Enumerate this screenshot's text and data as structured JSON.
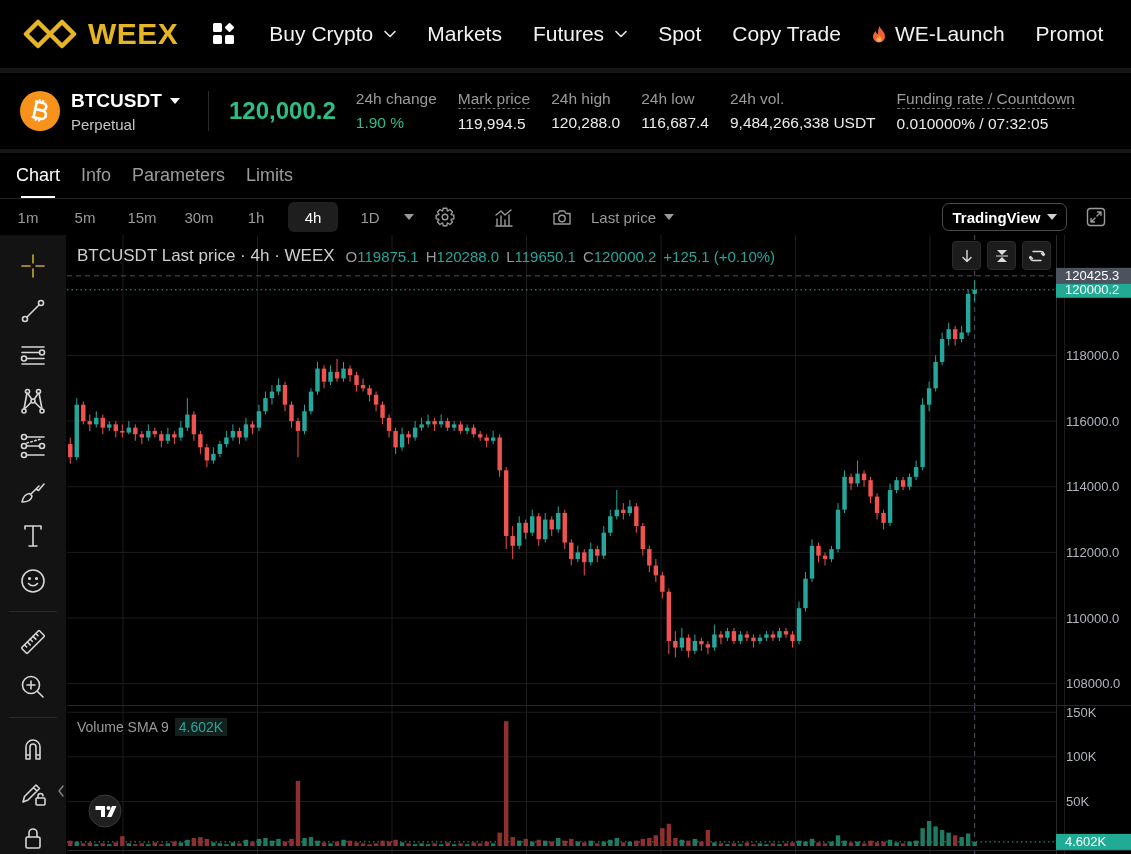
{
  "nav": {
    "logo": "WEEX",
    "items": [
      {
        "label": "Buy Crypto",
        "kind": "dropdown"
      },
      {
        "label": "Markets",
        "kind": "link"
      },
      {
        "label": "Futures",
        "kind": "dropdown"
      },
      {
        "label": "Spot",
        "kind": "link"
      },
      {
        "label": "Copy Trade",
        "kind": "link"
      },
      {
        "label": "WE-Launch",
        "kind": "hot"
      },
      {
        "label": "Promot",
        "kind": "link"
      }
    ]
  },
  "ticker": {
    "symbol": "BTCUSDT",
    "contract": "Perpetual",
    "last_price": "120,000.2",
    "stats": [
      {
        "label": "24h change",
        "value": "1.90 %",
        "kind": "change"
      },
      {
        "label": "Mark price",
        "value": "119,994.5",
        "kind": "hint"
      },
      {
        "label": "24h high",
        "value": "120,288.0",
        "kind": "plain"
      },
      {
        "label": "24h low",
        "value": "116,687.4",
        "kind": "plain"
      },
      {
        "label": "24h vol.",
        "value": "9,484,266,338 USDT",
        "kind": "plain"
      },
      {
        "label": "Funding rate / Countdown",
        "value": "0.010000% / 07:32:05",
        "kind": "hint"
      }
    ]
  },
  "tabs": [
    {
      "label": "Chart",
      "selected": true
    },
    {
      "label": "Info",
      "selected": false
    },
    {
      "label": "Parameters",
      "selected": false
    },
    {
      "label": "Limits",
      "selected": false
    }
  ],
  "toolbar": {
    "intervals": [
      {
        "label": "1m",
        "selected": false
      },
      {
        "label": "5m",
        "selected": false
      },
      {
        "label": "15m",
        "selected": false
      },
      {
        "label": "30m",
        "selected": false
      },
      {
        "label": "1h",
        "selected": false
      },
      {
        "label": "4h",
        "selected": true
      },
      {
        "label": "1D",
        "selected": false
      }
    ],
    "price_source": "Last price",
    "chart_type": "TradingView"
  },
  "chart": {
    "legend": {
      "title": "BTCUSDT Last price · 4h · WEEX",
      "ohlc": [
        {
          "key": "O",
          "value": "119875.1"
        },
        {
          "key": "H",
          "value": "120288.0"
        },
        {
          "key": "L",
          "value": "119650.1"
        },
        {
          "key": "C",
          "value": "120000.2"
        }
      ],
      "change": "+125.1 (+0.10%)"
    },
    "tool_groups": [
      {
        "tools": [
          {
            "kind": "crosshair",
            "selected": true
          },
          {
            "kind": "trend-line",
            "selected": false
          },
          {
            "kind": "parallel-lines",
            "selected": false
          },
          {
            "kind": "pattern",
            "selected": false
          },
          {
            "kind": "fib",
            "selected": false
          },
          {
            "kind": "brush",
            "selected": false
          },
          {
            "kind": "text",
            "selected": false
          },
          {
            "kind": "emoji",
            "selected": false
          }
        ]
      },
      {
        "tools": [
          {
            "kind": "ruler",
            "selected": false
          },
          {
            "kind": "zoom-in",
            "selected": false
          }
        ]
      },
      {
        "tools": [
          {
            "kind": "magnet",
            "selected": false
          },
          {
            "kind": "lock-drawing",
            "selected": false
          },
          {
            "kind": "lock",
            "selected": false
          }
        ]
      }
    ],
    "volume_legend": {
      "label": "Volume SMA 9",
      "value": "4.602K"
    },
    "chart_data": [
      {
        "type": "candlestick",
        "ylim": [
          107350,
          121670
        ],
        "yticks": [
          {
            "value": 108000,
            "label": "108000.0"
          },
          {
            "value": 110000,
            "label": "110000.0"
          },
          {
            "value": 112000,
            "label": "112000.0"
          },
          {
            "value": 114000,
            "label": "114000.0"
          },
          {
            "value": 116000,
            "label": "116000.0"
          },
          {
            "value": 118000,
            "label": "118000.0"
          }
        ],
        "grid": true,
        "ref_lines": [
          {
            "axis": "y",
            "value": 120425.3,
            "label": "120425.3",
            "color": "#4c525e",
            "line_style": "dashed"
          },
          {
            "axis": "y",
            "value": 120000.2,
            "label": "120000.2",
            "color": "#22ab94",
            "line_style": "dotted"
          }
        ],
        "ohlc": [
          [
            115300,
            115500,
            114700,
            114900
          ],
          [
            114900,
            116700,
            114800,
            116500
          ],
          [
            116500,
            116600,
            115900,
            116000
          ],
          [
            116000,
            116200,
            115700,
            115900
          ],
          [
            115900,
            116300,
            115800,
            116100
          ],
          [
            116100,
            116200,
            115600,
            115800
          ],
          [
            115800,
            116000,
            115700,
            115900
          ],
          [
            115900,
            116000,
            115500,
            115700
          ],
          [
            115700,
            115900,
            115500,
            115650
          ],
          [
            115650,
            116000,
            115600,
            115800
          ],
          [
            115800,
            115900,
            115400,
            115600
          ],
          [
            115600,
            115700,
            115300,
            115500
          ],
          [
            115500,
            115900,
            115400,
            115700
          ],
          [
            115700,
            115800,
            115500,
            115600
          ],
          [
            115600,
            115700,
            115200,
            115400
          ],
          [
            115400,
            115800,
            115300,
            115600
          ],
          [
            115600,
            115700,
            115300,
            115500
          ],
          [
            115500,
            116000,
            115400,
            115800
          ],
          [
            115800,
            116700,
            115700,
            116200
          ],
          [
            116200,
            116300,
            115400,
            115600
          ],
          [
            115600,
            115700,
            115000,
            115200
          ],
          [
            115200,
            115300,
            114600,
            114800
          ],
          [
            114800,
            115200,
            114700,
            115000
          ],
          [
            115000,
            115400,
            114900,
            115300
          ],
          [
            115300,
            115700,
            115200,
            115500
          ],
          [
            115500,
            115900,
            115400,
            115700
          ],
          [
            115700,
            115800,
            115300,
            115500
          ],
          [
            115500,
            116100,
            115400,
            115900
          ],
          [
            115900,
            116000,
            115600,
            115800
          ],
          [
            115800,
            116500,
            115700,
            116300
          ],
          [
            116300,
            116900,
            116200,
            116700
          ],
          [
            116700,
            117100,
            116500,
            116900
          ],
          [
            116900,
            117300,
            116800,
            117100
          ],
          [
            117100,
            117200,
            116300,
            116500
          ],
          [
            116500,
            116600,
            115800,
            116000
          ],
          [
            116000,
            116100,
            114900,
            115700
          ],
          [
            115700,
            116500,
            115600,
            116300
          ],
          [
            116300,
            117000,
            116200,
            116900
          ],
          [
            116900,
            117800,
            116800,
            117600
          ],
          [
            117600,
            117700,
            117000,
            117200
          ],
          [
            117200,
            117700,
            117100,
            117500
          ],
          [
            117500,
            117900,
            117200,
            117300
          ],
          [
            117300,
            117800,
            117200,
            117600
          ],
          [
            117600,
            117700,
            117200,
            117400
          ],
          [
            117400,
            117500,
            116900,
            117100
          ],
          [
            117100,
            117300,
            116900,
            117000
          ],
          [
            117000,
            117100,
            116600,
            116800
          ],
          [
            116800,
            116900,
            116300,
            116500
          ],
          [
            116500,
            116600,
            115900,
            116100
          ],
          [
            116100,
            116200,
            115500,
            115700
          ],
          [
            115700,
            115800,
            115000,
            115200
          ],
          [
            115200,
            115800,
            115100,
            115600
          ],
          [
            115600,
            115700,
            115300,
            115500
          ],
          [
            115500,
            116000,
            115400,
            115800
          ],
          [
            115800,
            116100,
            115700,
            115900
          ],
          [
            115900,
            116200,
            115800,
            116000
          ],
          [
            116000,
            116100,
            115700,
            115900
          ],
          [
            115900,
            116200,
            115800,
            116000
          ],
          [
            116000,
            116100,
            115700,
            115800
          ],
          [
            115800,
            116000,
            115700,
            115900
          ],
          [
            115900,
            116000,
            115600,
            115700
          ],
          [
            115700,
            115900,
            115600,
            115800
          ],
          [
            115800,
            115900,
            115500,
            115600
          ],
          [
            115600,
            115700,
            115400,
            115500
          ],
          [
            115500,
            115600,
            115200,
            115400
          ],
          [
            115400,
            115700,
            115300,
            115500
          ],
          [
            115500,
            115600,
            114300,
            114500
          ],
          [
            114500,
            114600,
            112100,
            112500
          ],
          [
            112500,
            112800,
            111800,
            112200
          ],
          [
            112200,
            113100,
            112100,
            112900
          ],
          [
            112900,
            113000,
            112400,
            112600
          ],
          [
            112600,
            113300,
            112500,
            113100
          ],
          [
            113100,
            113200,
            112200,
            112400
          ],
          [
            112400,
            113200,
            112300,
            113000
          ],
          [
            113000,
            113100,
            112500,
            112700
          ],
          [
            112700,
            113400,
            112600,
            113200
          ],
          [
            113200,
            113300,
            112100,
            112300
          ],
          [
            112300,
            112400,
            111600,
            111800
          ],
          [
            111800,
            112200,
            111700,
            112000
          ],
          [
            112000,
            112100,
            111300,
            111700
          ],
          [
            111700,
            112300,
            111600,
            112100
          ],
          [
            112100,
            112200,
            111700,
            111900
          ],
          [
            111900,
            112800,
            111800,
            112600
          ],
          [
            112600,
            113300,
            112500,
            113100
          ],
          [
            113100,
            113900,
            113000,
            113300
          ],
          [
            113300,
            113500,
            113000,
            113200
          ],
          [
            113200,
            113600,
            113100,
            113400
          ],
          [
            113400,
            113500,
            112600,
            112800
          ],
          [
            112800,
            112900,
            111900,
            112100
          ],
          [
            112100,
            112200,
            111400,
            111600
          ],
          [
            111600,
            111800,
            111100,
            111300
          ],
          [
            111300,
            111400,
            110600,
            110800
          ],
          [
            110800,
            110900,
            108900,
            109300
          ],
          [
            109300,
            109600,
            108800,
            109100
          ],
          [
            109100,
            109700,
            109000,
            109400
          ],
          [
            109400,
            109500,
            108800,
            109000
          ],
          [
            109000,
            109500,
            108900,
            109300
          ],
          [
            109300,
            109400,
            109000,
            109200
          ],
          [
            109200,
            109300,
            108900,
            109100
          ],
          [
            109100,
            109800,
            109000,
            109500
          ],
          [
            109500,
            109600,
            109200,
            109400
          ],
          [
            109400,
            109700,
            109300,
            109600
          ],
          [
            109600,
            109700,
            109200,
            109300
          ],
          [
            109300,
            109600,
            109200,
            109500
          ],
          [
            109500,
            109600,
            109300,
            109400
          ],
          [
            109400,
            109500,
            109100,
            109300
          ],
          [
            109300,
            109500,
            109200,
            109400
          ],
          [
            109400,
            109600,
            109300,
            109500
          ],
          [
            109500,
            109600,
            109300,
            109400
          ],
          [
            109400,
            109700,
            109300,
            109600
          ],
          [
            109600,
            109700,
            109400,
            109500
          ],
          [
            109500,
            109600,
            109100,
            109300
          ],
          [
            109300,
            110500,
            109200,
            110300
          ],
          [
            110300,
            111400,
            110200,
            111200
          ],
          [
            111200,
            112400,
            111100,
            112200
          ],
          [
            112200,
            112300,
            111700,
            111900
          ],
          [
            111900,
            112000,
            111600,
            111800
          ],
          [
            111800,
            112200,
            111700,
            112100
          ],
          [
            112100,
            113500,
            112000,
            113300
          ],
          [
            113300,
            114500,
            113200,
            114300
          ],
          [
            114300,
            114400,
            113900,
            114100
          ],
          [
            114100,
            114800,
            114000,
            114400
          ],
          [
            114400,
            114500,
            114000,
            114200
          ],
          [
            114200,
            114300,
            113500,
            113700
          ],
          [
            113700,
            113800,
            113000,
            113200
          ],
          [
            113200,
            113300,
            112700,
            112900
          ],
          [
            112900,
            114100,
            112800,
            113900
          ],
          [
            113900,
            114300,
            113800,
            114200
          ],
          [
            114200,
            114300,
            113900,
            114000
          ],
          [
            114000,
            114400,
            113900,
            114300
          ],
          [
            114300,
            114800,
            114200,
            114600
          ],
          [
            114600,
            116700,
            114500,
            116500
          ],
          [
            116500,
            117200,
            116300,
            117000
          ],
          [
            117000,
            118000,
            116900,
            117800
          ],
          [
            117800,
            118700,
            117700,
            118500
          ],
          [
            118500,
            119000,
            118300,
            118800
          ],
          [
            118800,
            118900,
            118300,
            118500
          ],
          [
            118500,
            118900,
            118400,
            118700
          ],
          [
            118700,
            120000,
            118600,
            119875.1
          ],
          [
            119875.1,
            120288,
            119650.1,
            120000.2
          ],
          null,
          null,
          null,
          null,
          null,
          null,
          null,
          null,
          null,
          null,
          null,
          null
        ]
      },
      {
        "type": "bar",
        "ylim": [
          0,
          157000
        ],
        "yticks": [
          {
            "value": 50000,
            "label": "50K"
          },
          {
            "value": 100000,
            "label": "100K"
          },
          {
            "value": 150000,
            "label": "150K"
          }
        ],
        "grid": true,
        "ref_lines": [
          {
            "axis": "y",
            "value": 4602,
            "label": "4.602K",
            "color": "#22ab94",
            "line_style": "dotted"
          }
        ],
        "values": [
          6000,
          5000,
          3000,
          4000,
          2000,
          3000,
          2000,
          4000,
          11000,
          3000,
          2000,
          3000,
          2000,
          4000,
          2000,
          3000,
          5000,
          4000,
          7000,
          9000,
          10000,
          8000,
          4000,
          3000,
          2000,
          4000,
          3000,
          7000,
          5000,
          8000,
          9000,
          6000,
          8000,
          5000,
          8000,
          73000,
          9000,
          10000,
          6000,
          4000,
          3000,
          5000,
          7000,
          6000,
          4000,
          3000,
          2000,
          3000,
          6000,
          5000,
          7000,
          4000,
          3000,
          2000,
          3000,
          2000,
          3000,
          2000,
          4000,
          2000,
          3000,
          2000,
          4000,
          3000,
          5000,
          3000,
          15000,
          140000,
          10000,
          6000,
          8000,
          5000,
          7000,
          6000,
          5000,
          9000,
          6000,
          8000,
          5000,
          4000,
          6000,
          3000,
          5000,
          7000,
          9000,
          4000,
          5000,
          6000,
          8000,
          9000,
          12000,
          20000,
          25000,
          9000,
          7000,
          6000,
          8000,
          5000,
          18000,
          4000,
          3000,
          2000,
          3000,
          2000,
          4000,
          2000,
          3000,
          2000,
          3000,
          2000,
          3000,
          4000,
          6000,
          5000,
          8000,
          4000,
          3000,
          5000,
          12000,
          6000,
          4000,
          5000,
          3000,
          6000,
          4000,
          5000,
          7000,
          4000,
          3000,
          5000,
          6000,
          20000,
          28000,
          22000,
          18000,
          15000,
          12000,
          10000,
          14000,
          4602,
          null,
          null,
          null,
          null,
          null,
          null,
          null,
          null,
          null,
          null,
          null,
          null
        ],
        "colors": [
          "#8f2f2f",
          "#1f7a64",
          "#8f2f2f",
          "#8f2f2f",
          "#1f7a64",
          "#8f2f2f",
          "#1f7a64",
          "#8f2f2f",
          "#8f2f2f",
          "#1f7a64",
          "#8f2f2f",
          "#8f2f2f",
          "#1f7a64",
          "#8f2f2f",
          "#8f2f2f",
          "#1f7a64",
          "#8f2f2f",
          "#1f7a64",
          "#1f7a64",
          "#8f2f2f",
          "#8f2f2f",
          "#8f2f2f",
          "#1f7a64",
          "#1f7a64",
          "#1f7a64",
          "#1f7a64",
          "#8f2f2f",
          "#1f7a64",
          "#8f2f2f",
          "#1f7a64",
          "#1f7a64",
          "#1f7a64",
          "#1f7a64",
          "#8f2f2f",
          "#8f2f2f",
          "#8f2f2f",
          "#1f7a64",
          "#1f7a64",
          "#1f7a64",
          "#8f2f2f",
          "#1f7a64",
          "#8f2f2f",
          "#1f7a64",
          "#8f2f2f",
          "#8f2f2f",
          "#8f2f2f",
          "#8f2f2f",
          "#8f2f2f",
          "#8f2f2f",
          "#8f2f2f",
          "#8f2f2f",
          "#1f7a64",
          "#8f2f2f",
          "#1f7a64",
          "#1f7a64",
          "#1f7a64",
          "#8f2f2f",
          "#1f7a64",
          "#8f2f2f",
          "#1f7a64",
          "#8f2f2f",
          "#1f7a64",
          "#8f2f2f",
          "#8f2f2f",
          "#8f2f2f",
          "#1f7a64",
          "#8f2f2f",
          "#8f2f2f",
          "#8f2f2f",
          "#1f7a64",
          "#8f2f2f",
          "#1f7a64",
          "#8f2f2f",
          "#1f7a64",
          "#8f2f2f",
          "#1f7a64",
          "#8f2f2f",
          "#8f2f2f",
          "#1f7a64",
          "#8f2f2f",
          "#1f7a64",
          "#8f2f2f",
          "#1f7a64",
          "#1f7a64",
          "#1f7a64",
          "#8f2f2f",
          "#1f7a64",
          "#8f2f2f",
          "#8f2f2f",
          "#8f2f2f",
          "#8f2f2f",
          "#8f2f2f",
          "#8f2f2f",
          "#8f2f2f",
          "#1f7a64",
          "#8f2f2f",
          "#1f7a64",
          "#8f2f2f",
          "#8f2f2f",
          "#1f7a64",
          "#8f2f2f",
          "#1f7a64",
          "#8f2f2f",
          "#1f7a64",
          "#8f2f2f",
          "#8f2f2f",
          "#1f7a64",
          "#1f7a64",
          "#8f2f2f",
          "#1f7a64",
          "#8f2f2f",
          "#8f2f2f",
          "#1f7a64",
          "#1f7a64",
          "#1f7a64",
          "#8f2f2f",
          "#8f2f2f",
          "#1f7a64",
          "#1f7a64",
          "#1f7a64",
          "#8f2f2f",
          "#1f7a64",
          "#8f2f2f",
          "#8f2f2f",
          "#8f2f2f",
          "#8f2f2f",
          "#1f7a64",
          "#1f7a64",
          "#8f2f2f",
          "#1f7a64",
          "#1f7a64",
          "#1f7a64",
          "#1f7a64",
          "#1f7a64",
          "#1f7a64",
          "#1f7a64",
          "#8f2f2f",
          "#1f7a64",
          "#1f7a64",
          "#1f7a64",
          null,
          null,
          null,
          null,
          null,
          null,
          null,
          null,
          null,
          null,
          null,
          null
        ]
      }
    ]
  }
}
